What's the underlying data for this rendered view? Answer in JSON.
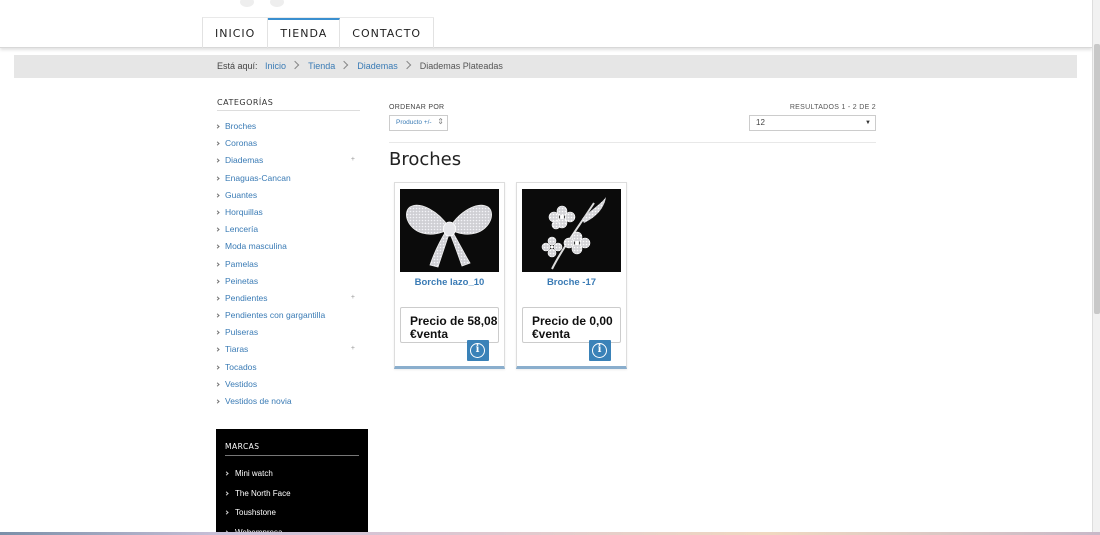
{
  "nav": {
    "items": [
      "INICIO",
      "TIENDA",
      "CONTACTO"
    ],
    "active": "TIENDA"
  },
  "breadcrumb": {
    "label": "Está aquí:",
    "links": [
      "Inicio",
      "Tienda",
      "Diademas"
    ],
    "current": "Diademas Plateadas"
  },
  "sidebar": {
    "title": "CATEGORÍAS",
    "items": [
      {
        "label": "Broches",
        "expandable": false
      },
      {
        "label": "Coronas",
        "expandable": false
      },
      {
        "label": "Diademas",
        "expandable": true
      },
      {
        "label": "Enaguas-Cancan",
        "expandable": false
      },
      {
        "label": "Guantes",
        "expandable": false
      },
      {
        "label": "Horquillas",
        "expandable": false
      },
      {
        "label": "Lencería",
        "expandable": false
      },
      {
        "label": "Moda masculina",
        "expandable": false
      },
      {
        "label": "Pamelas",
        "expandable": false
      },
      {
        "label": "Peinetas",
        "expandable": false
      },
      {
        "label": "Pendientes",
        "expandable": true
      },
      {
        "label": "Pendientes con gargantilla",
        "expandable": false
      },
      {
        "label": "Pulseras",
        "expandable": false
      },
      {
        "label": "Tiaras",
        "expandable": true
      },
      {
        "label": "Tocados",
        "expandable": false
      },
      {
        "label": "Vestidos",
        "expandable": false
      },
      {
        "label": "Vestidos de novia",
        "expandable": false
      }
    ],
    "expand_symbol": "+"
  },
  "marcas": {
    "title": "MARCAS",
    "items": [
      "Mini watch",
      "The North Face",
      "Toushstone",
      "Webempresa"
    ]
  },
  "sort": {
    "label": "ORDENAR POR",
    "value": "Producto +/-"
  },
  "results": {
    "text": "RESULTADOS 1 - 2 DE 2",
    "per_page": "12"
  },
  "section": {
    "title": "Broches"
  },
  "products": [
    {
      "name": "Borche lazo_10",
      "price": "Precio de 58,08 €venta",
      "image": "bow-brooch"
    },
    {
      "name": "Broche -17",
      "price": "Precio de 0,00 €venta",
      "image": "flower-brooch"
    }
  ],
  "colors": {
    "link": "#3a7bb5",
    "accent": "#3a82b8",
    "marcas_bg": "#000000"
  }
}
